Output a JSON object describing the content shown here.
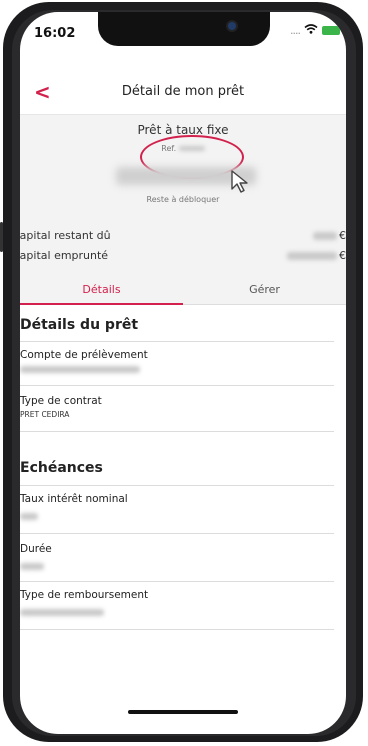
{
  "status_bar": {
    "time": "16:02",
    "signal": "....",
    "wifi_icon": "wifi-icon",
    "battery_icon": "battery-charging-icon"
  },
  "navbar": {
    "back_icon": "chevron-left-icon",
    "back_label": "<",
    "title": "Détail de mon prêt"
  },
  "summary": {
    "loan_type": "Prêt à taux fixe",
    "reference_label": "Ref.",
    "remaining_label": "Reste à débloquer",
    "rows": [
      {
        "label": "Capital restant dû",
        "currency": "€"
      },
      {
        "label": "Capital emprunté",
        "currency": "€"
      }
    ],
    "annotation_color": "#d2214c"
  },
  "tabs": [
    {
      "label": "Détails",
      "active": true
    },
    {
      "label": "Gérer",
      "active": false
    }
  ],
  "sections": {
    "details": {
      "title": "Détails du prêt",
      "fields": [
        {
          "label": "Compte de prélèvement"
        },
        {
          "label": "Type de contrat",
          "value": "PRET CEDIRA"
        }
      ]
    },
    "echeances": {
      "title": "Echéances",
      "fields": [
        {
          "label": "Taux intérêt nominal"
        },
        {
          "label": "Durée"
        },
        {
          "label": "Type de remboursement"
        }
      ]
    }
  },
  "colors": {
    "accent": "#d2214c",
    "background_panel": "#f3f3f3"
  }
}
